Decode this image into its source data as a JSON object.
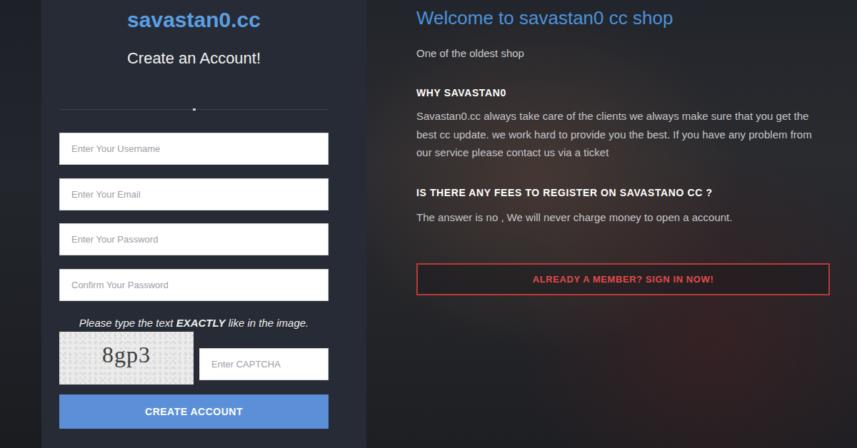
{
  "register": {
    "title": "savastan0.cc",
    "subtitle": "Create an Account!",
    "fields": [
      {
        "placeholder": "Enter Your Username",
        "type": "text"
      },
      {
        "placeholder": "Enter Your Email",
        "type": "email"
      },
      {
        "placeholder": "Enter Your Password",
        "type": "password"
      },
      {
        "placeholder": "Confirm Your Password",
        "type": "password"
      }
    ],
    "captcha": {
      "instruction_before": "Please type the text ",
      "instruction_emphasis": "EXACTLY",
      "instruction_after": " like in the image.",
      "code": "8gp3",
      "placeholder": "Enter CAPTCHA"
    },
    "submit": "CREATE ACCOUNT"
  },
  "info": {
    "heading": "Welcome to savastan0 cc shop",
    "tagline": "One of the oldest shop",
    "sections": [
      {
        "heading": "WHY SAVASTAN0",
        "body": "Savastan0.cc always take care of the clients we always make sure that you get the best cc update. we work hard to provide you the best. If you have any problem from our service please contact us via a ticket"
      },
      {
        "heading": "IS THERE ANY FEES TO REGISTER ON SAVASTANO CC ?",
        "body": "The answer is no , We will never charge money to open a account."
      }
    ],
    "signin": "ALREADY A MEMBER? SIGN IN NOW!"
  }
}
